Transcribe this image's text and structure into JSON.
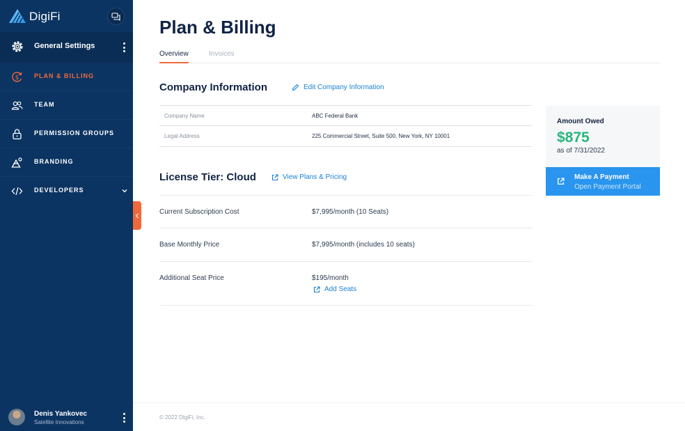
{
  "app": {
    "name": "DigiFi"
  },
  "sidebar": {
    "settings_label": "General Settings",
    "items": [
      {
        "label": "PLAN & BILLING",
        "icon": "billing-icon",
        "active": true
      },
      {
        "label": "TEAM",
        "icon": "team-icon",
        "active": false
      },
      {
        "label": "PERMISSION GROUPS",
        "icon": "lock-icon",
        "active": false
      },
      {
        "label": "BRANDING",
        "icon": "branding-icon",
        "active": false
      },
      {
        "label": "DEVELOPERS",
        "icon": "code-icon",
        "active": false
      }
    ],
    "user": {
      "name": "Denis Yankovec",
      "organization": "Satellite Innovations"
    }
  },
  "page": {
    "title": "Plan & Billing",
    "tabs": [
      {
        "label": "Overview",
        "active": true
      },
      {
        "label": "Invoices",
        "active": false
      }
    ]
  },
  "company": {
    "title": "Company Information",
    "edit_link": "Edit Company Information",
    "rows": [
      {
        "label": "Company Name",
        "value": "ABC Federal Bank"
      },
      {
        "label": "Legal Address",
        "value": "225 Commercial Street, Suite 500, New York, NY 10001"
      }
    ]
  },
  "license": {
    "title": "License Tier: Cloud",
    "plans_link": "View Plans & Pricing",
    "rows": [
      {
        "label": "Current Subscription Cost",
        "value": "$7,995/month (10 Seats)"
      },
      {
        "label": "Base Monthly Price",
        "value": "$7,995/month (includes 10 seats)"
      },
      {
        "label": "Additional Seat Price",
        "value": "$195/month",
        "link": "Add Seats"
      }
    ]
  },
  "billing": {
    "owed_title": "Amount Owed",
    "owed_amount": "$875",
    "owed_date": "as of 7/31/2022",
    "pay_title": "Make A Payment",
    "pay_subtitle": "Open Payment Portal"
  },
  "footer": {
    "text": "© 2022 DigiFi, Inc."
  },
  "colors": {
    "sidebar_bg": "#0c3462",
    "accent_orange": "#f1693b",
    "link_blue": "#1a7fd4",
    "pay_blue": "#2995ee",
    "owed_green": "#28b57c"
  }
}
